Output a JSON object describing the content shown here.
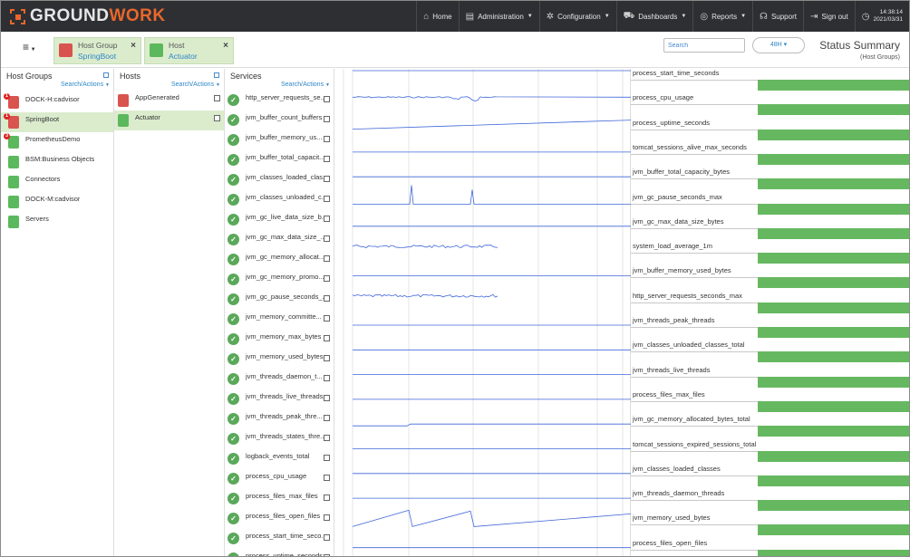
{
  "brand": {
    "name_a": "GROUND",
    "name_b": "WORK",
    "accent": "#e9672b"
  },
  "nav": [
    {
      "id": "home",
      "label": "Home",
      "icon": "home-icon",
      "glyph": "⌂",
      "dropdown": false
    },
    {
      "id": "administration",
      "label": "Administration",
      "icon": "clipboard-icon",
      "glyph": "▤",
      "dropdown": true
    },
    {
      "id": "configuration",
      "label": "Configuration",
      "icon": "gears-icon",
      "glyph": "✲",
      "dropdown": true
    },
    {
      "id": "dashboards",
      "label": "Dashboards",
      "icon": "cart-icon",
      "glyph": "⛟",
      "dropdown": true
    },
    {
      "id": "reports",
      "label": "Reports",
      "icon": "eye-icon",
      "glyph": "◎",
      "dropdown": true
    },
    {
      "id": "support",
      "label": "Support",
      "icon": "headset-icon",
      "glyph": "☊",
      "dropdown": false
    },
    {
      "id": "signout",
      "label": "Sign out",
      "icon": "sign-out-icon",
      "glyph": "⇥",
      "dropdown": false
    }
  ],
  "clock": {
    "time": "14:38:14",
    "date": "2021/03/31"
  },
  "tabs": [
    {
      "type": "Host Group",
      "name": "SpringBoot",
      "icon_color": "#d9534f",
      "close": "×"
    },
    {
      "type": "Host",
      "name": "Actuator",
      "icon_color": "#5cb85c",
      "close": "×"
    }
  ],
  "search": {
    "placeholder": "Search",
    "value": ""
  },
  "time_range": "48H ▾",
  "page": {
    "title": "Status Summary",
    "subtitle": "(Host Groups)"
  },
  "columns": {
    "host_groups": {
      "title": "Host Groups",
      "search_actions": "Search/Actions"
    },
    "hosts": {
      "title": "Hosts",
      "search_actions": "Search/Actions"
    },
    "services": {
      "title": "Services",
      "search_actions": "Search/Actions"
    }
  },
  "host_groups": [
    {
      "name": "DOCK-H:cadvisor",
      "color": "#d9534f",
      "badge": "1",
      "selected": false
    },
    {
      "name": "SpringBoot",
      "color": "#d9534f",
      "badge": "1",
      "selected": true
    },
    {
      "name": "PrometheusDemo",
      "color": "#5cb85c",
      "badge": "3",
      "selected": false
    },
    {
      "name": "BSM:Business Objects",
      "color": "#5cb85c",
      "badge": "",
      "selected": false
    },
    {
      "name": "Connectors",
      "color": "#5cb85c",
      "badge": "",
      "selected": false
    },
    {
      "name": "DOCK-M:cadvisor",
      "color": "#5cb85c",
      "badge": "",
      "selected": false
    },
    {
      "name": "Servers",
      "color": "#5cb85c",
      "badge": "",
      "selected": false
    }
  ],
  "hosts": [
    {
      "name": "AppGenerated",
      "color": "#d9534f",
      "selected": false
    },
    {
      "name": "Actuator",
      "color": "#5cb85c",
      "selected": true
    }
  ],
  "services": [
    "http_server_requests_se...",
    "jvm_buffer_count_buffers",
    "jvm_buffer_memory_us...",
    "jvm_buffer_total_capacit...",
    "jvm_classes_loaded_clas...",
    "jvm_classes_unloaded_c...",
    "jvm_gc_live_data_size_b...",
    "jvm_gc_max_data_size_...",
    "jvm_gc_memory_allocat...",
    "jvm_gc_memory_promo...",
    "jvm_gc_pause_seconds_...",
    "jvm_memory_committe...",
    "jvm_memory_max_bytes",
    "jvm_memory_used_bytes",
    "jvm_threads_daemon_t...",
    "jvm_threads_live_threads",
    "jvm_threads_peak_thre...",
    "jvm_threads_states_thre...",
    "logback_events_total",
    "process_cpu_usage",
    "process_files_max_files",
    "process_files_open_files",
    "process_start_time_seco...",
    "process_uptime_seconds"
  ],
  "metrics": [
    {
      "name": "process_start_time_seconds",
      "shape": "flat_high"
    },
    {
      "name": "process_cpu_usage",
      "shape": "noisy_dip"
    },
    {
      "name": "process_uptime_seconds",
      "shape": "rising"
    },
    {
      "name": "tomcat_sessions_alive_max_seconds",
      "shape": "flat_low"
    },
    {
      "name": "jvm_buffer_total_capacity_bytes",
      "shape": "flat_low"
    },
    {
      "name": "jvm_gc_pause_seconds_max",
      "shape": "spikes"
    },
    {
      "name": "jvm_gc_max_data_size_bytes",
      "shape": "flat_low"
    },
    {
      "name": "system_load_average_1m",
      "shape": "noisy"
    },
    {
      "name": "jvm_buffer_memory_used_bytes",
      "shape": "flat_low"
    },
    {
      "name": "http_server_requests_seconds_max",
      "shape": "noisy"
    },
    {
      "name": "jvm_threads_peak_threads",
      "shape": "flat_low"
    },
    {
      "name": "jvm_classes_unloaded_classes_total",
      "shape": "flat_low"
    },
    {
      "name": "jvm_threads_live_threads",
      "shape": "flat_low"
    },
    {
      "name": "process_files_max_files",
      "shape": "flat_low"
    },
    {
      "name": "jvm_gc_memory_allocated_bytes_total",
      "shape": "step"
    },
    {
      "name": "tomcat_sessions_expired_sessions_total",
      "shape": "flat_low"
    },
    {
      "name": "jvm_classes_loaded_classes",
      "shape": "flat_low"
    },
    {
      "name": "jvm_threads_daemon_threads",
      "shape": "flat_low"
    },
    {
      "name": "jvm_memory_used_bytes",
      "shape": "sawtooth"
    },
    {
      "name": "process_files_open_files",
      "shape": "flat_low"
    }
  ],
  "colors": {
    "ok": "#5aa85a",
    "bar": "#66b860",
    "line": "#3f66d8",
    "selection": "#dbeccd",
    "link": "#2f86c5"
  }
}
